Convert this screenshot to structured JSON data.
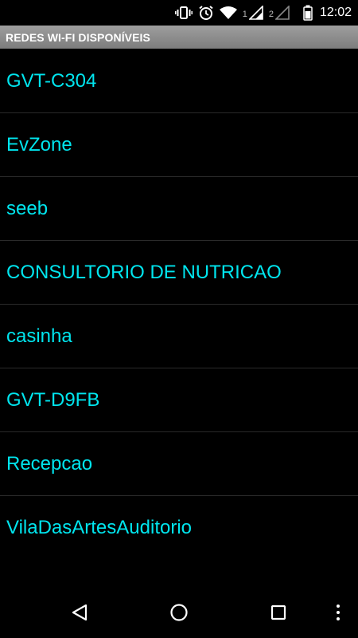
{
  "status_bar": {
    "time": "12:02",
    "sim1_label": "1",
    "sim2_label": "2",
    "icons": [
      "vibrate-icon",
      "alarm-icon",
      "wifi-icon",
      "signal-sim1-icon",
      "signal-sim2-icon",
      "battery-icon"
    ]
  },
  "header": {
    "title": "REDES WI-FI DISPONÍVEIS"
  },
  "networks": [
    {
      "ssid": "GVT-C304"
    },
    {
      "ssid": "EvZone"
    },
    {
      "ssid": "seeb"
    },
    {
      "ssid": "CONSULTORIO DE NUTRICAO"
    },
    {
      "ssid": "casinha"
    },
    {
      "ssid": "GVT-D9FB"
    },
    {
      "ssid": "Recepcao"
    },
    {
      "ssid": "VilaDasArtesAuditorio"
    }
  ],
  "nav_bar": {
    "icons": [
      "back-icon",
      "home-icon",
      "recents-icon",
      "overflow-menu-icon"
    ]
  },
  "colors": {
    "background": "#000000",
    "network_text": "#00e5ee",
    "title_bar": "#8a8a8a"
  }
}
